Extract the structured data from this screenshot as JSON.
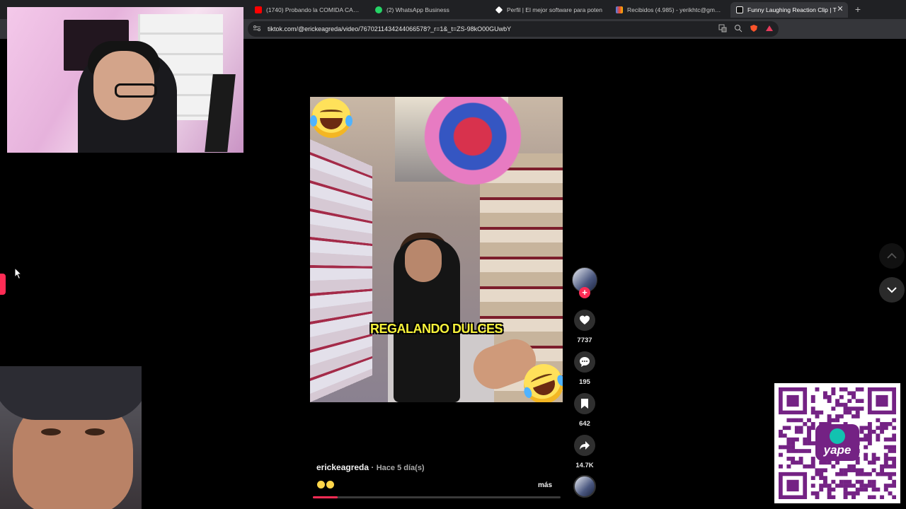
{
  "browser": {
    "tabs": [
      {
        "title": "(1740) Probando la COMIDA CALLEJ",
        "favicon_color": "#ff0000",
        "favicon": "youtube-icon"
      },
      {
        "title": "(2) WhatsApp Business",
        "favicon_color": "#25d366",
        "favicon": "whatsapp-icon"
      },
      {
        "title": "Perfil | El mejor software para poten",
        "favicon_color": "#ffffff",
        "favicon": "diamond-icon"
      },
      {
        "title": "Recibidos (4.985) - yerikhtc@gmail.c",
        "favicon_color": "#ea4335",
        "favicon": "gmail-icon"
      },
      {
        "title": "Funny Laughing Reaction Clip | T",
        "favicon_color": "#ffffff",
        "favicon": "tiktok-icon"
      }
    ],
    "close_label": "✕",
    "new_tab_label": "+",
    "url": "tiktok.com/@erickeagreda/video/7670211434244066578?_r=1&_t=ZS-98kO00GUwbY"
  },
  "video": {
    "caption_overlay": "REGALANDO DULCES",
    "progress_fraction": 0.1
  },
  "actions": {
    "likes": "7737",
    "comments": "195",
    "saves": "642",
    "shares": "14.7K",
    "follow_label": "+"
  },
  "info": {
    "author": "erickeagreda",
    "separator": " · ",
    "time": "Hace 5 día(s)",
    "more": "más"
  },
  "qr": {
    "brand": "yape",
    "brand_color": "#742284"
  },
  "colors": {
    "accent": "#fe2c55",
    "background": "#000000"
  }
}
